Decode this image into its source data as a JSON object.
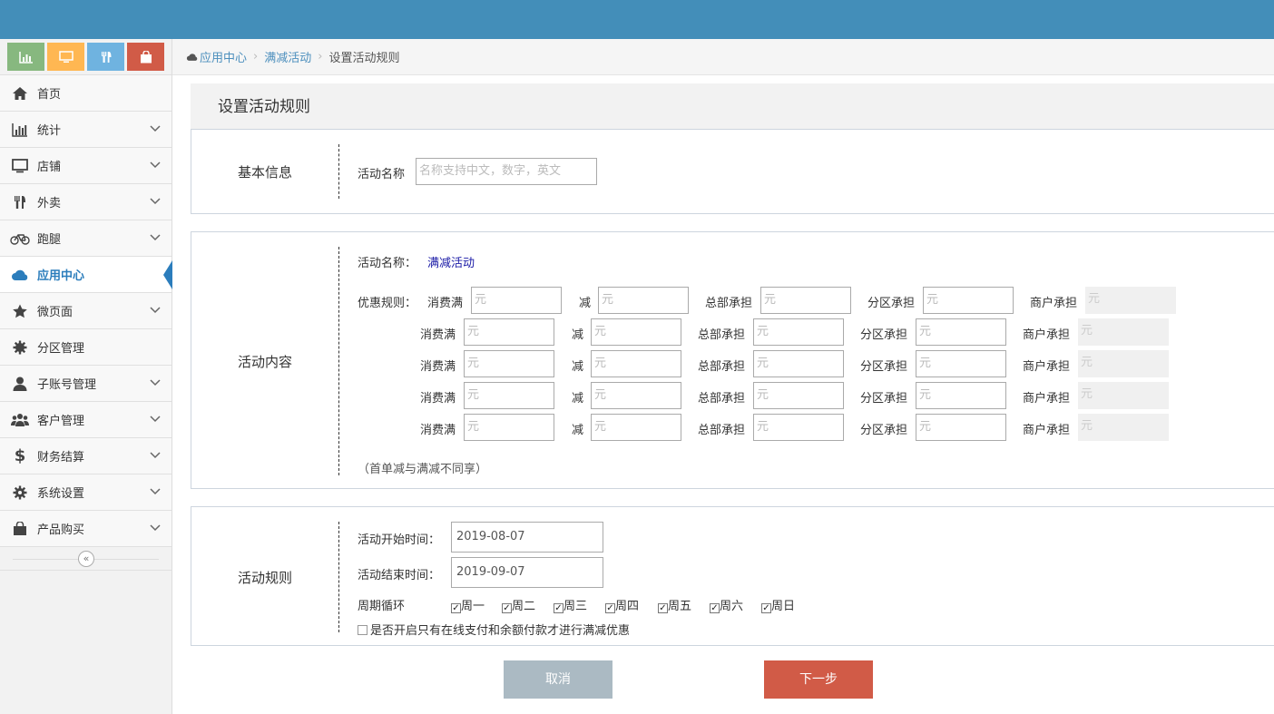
{
  "colors": {
    "topbar": "#438eb9",
    "shortcut_1": "#87b87f",
    "shortcut_2": "#ffb752",
    "shortcut_3": "#6fb3e0",
    "shortcut_4": "#d15b47",
    "cancel": "#abbac3",
    "next": "#d15b47",
    "active": "#2b7dbc"
  },
  "shortcuts": [
    "chart-icon",
    "monitor-icon",
    "fork-knife-icon",
    "shopping-bag-icon"
  ],
  "sidebar": {
    "items": [
      {
        "label": "首页",
        "icon": "home-icon"
      },
      {
        "label": "统计",
        "icon": "bar-chart-icon"
      },
      {
        "label": "店铺",
        "icon": "desktop-icon"
      },
      {
        "label": "外卖",
        "icon": "fork-knife-icon"
      },
      {
        "label": "跑腿",
        "icon": "bicycle-icon"
      },
      {
        "label": "应用中心",
        "icon": "cloud-icon"
      },
      {
        "label": "微页面",
        "icon": "star-icon"
      },
      {
        "label": "分区管理",
        "icon": "gear-icon"
      },
      {
        "label": "子账号管理",
        "icon": "user-icon"
      },
      {
        "label": "客户管理",
        "icon": "users-icon"
      },
      {
        "label": "财务结算",
        "icon": "dollar-icon"
      },
      {
        "label": "系统设置",
        "icon": "cog-icon"
      },
      {
        "label": "产品购买",
        "icon": "shopping-bag-icon"
      }
    ],
    "collapse_glyph": "«"
  },
  "breadcrumb": {
    "item1": "应用中心",
    "item2": "满减活动",
    "current": "设置活动规则",
    "sep": "›"
  },
  "page_title": "设置活动规则",
  "basic": {
    "section": "基本信息",
    "name_label": "活动名称",
    "name_placeholder": "名称支持中文，数字，英文"
  },
  "content": {
    "section": "活动内容",
    "activity_label": "活动名称：",
    "activity_value": "满减活动",
    "rules_label": "优惠规则：",
    "col_spend": "消费满",
    "col_minus": "减",
    "col_hq": "总部承担",
    "col_zone": "分区承担",
    "col_merchant": "商户承担",
    "unit": "元",
    "note": "（首单减与满减不同享）"
  },
  "rules": {
    "section": "活动规则",
    "start_label": "活动开始时间：",
    "start_value": "2019-08-07",
    "end_label": "活动结束时间：",
    "end_value": "2019-09-07",
    "cycle_label": "周期循环",
    "days": [
      "周一",
      "周二",
      "周三",
      "周四",
      "周五",
      "周六",
      "周日"
    ],
    "online_only": "是否开启只有在线支付和余额付款才进行满减优惠"
  },
  "buttons": {
    "cancel": "取消",
    "next": "下一步"
  }
}
